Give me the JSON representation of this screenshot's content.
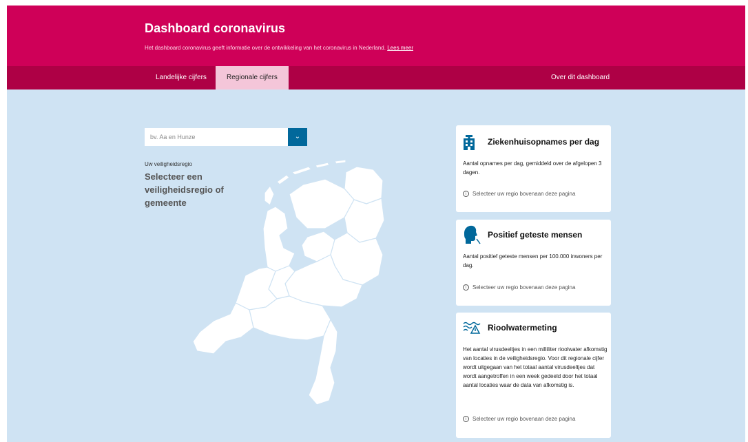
{
  "header": {
    "title": "Dashboard coronavirus",
    "intro": "Het dashboard coronavirus geeft informatie over de ontwikkeling van het coronavirus in Nederland.",
    "link": "Lees meer"
  },
  "nav": {
    "tabs": [
      {
        "label": "Landelijke cijfers"
      },
      {
        "label": "Regionale cijfers"
      }
    ],
    "about": "Over dit dashboard"
  },
  "search": {
    "placeholder": "bv. Aa en Hunze"
  },
  "region": {
    "label": "Uw veiligheidsregio",
    "title": "Selecteer een veiligheidsregio of gemeente"
  },
  "cards": [
    {
      "icon": "hospital-icon",
      "title": "Ziekenhuisopnames per dag",
      "description": "Aantal opnames per dag, gemiddeld over de afgelopen 3 dagen.",
      "hint": "Selecteer uw regio bovenaan deze pagina"
    },
    {
      "icon": "person-coughing-icon",
      "title": "Positief geteste mensen",
      "description": "Aantal positief geteste mensen per 100.000 inwoners per dag.",
      "hint": "Selecteer uw regio bovenaan deze pagina"
    },
    {
      "icon": "sewage-water-icon",
      "title": "Rioolwatermeting",
      "description": "Het aantal virusdeeltjes in een milliliter rioolwater afkomstig van locaties in de veiligheidsregio. Voor dit regionale cijfer wordt uitgegaan van het totaal aantal virusdeeltjes dat wordt aangetroffen in een week gedeeld door het totaal aantal locaties waar de data van afkomstig is.",
      "hint": "Selecteer uw regio bovenaan deze pagina"
    }
  ],
  "colors": {
    "brand": "#cf0058",
    "nav": "#ae0045",
    "active_tab": "#f4c6d9",
    "background": "#cfe3f3",
    "accent": "#01689b"
  }
}
